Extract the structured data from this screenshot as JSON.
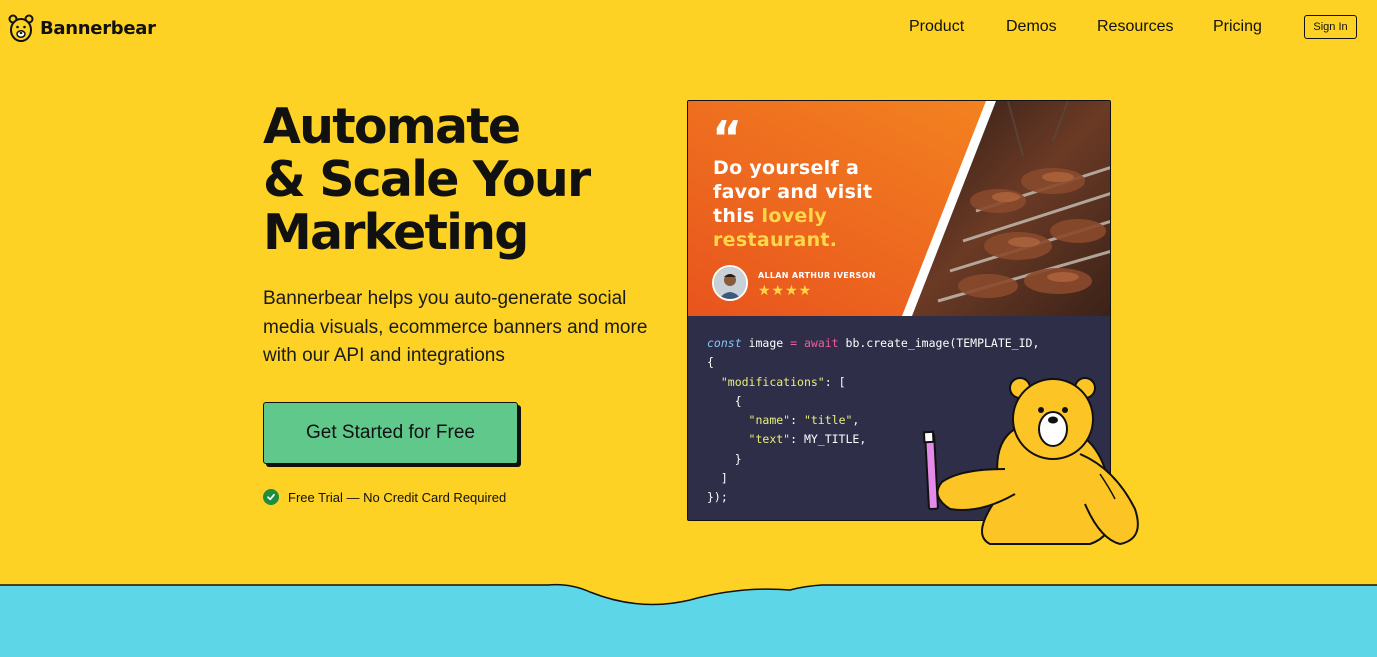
{
  "nav": {
    "brand": "Bannerbear",
    "links": [
      "Product",
      "Demos",
      "Resources",
      "Pricing"
    ],
    "sign_in": "Sign In"
  },
  "hero": {
    "title_lines": [
      "Automate",
      "& Scale Your",
      "Marketing"
    ],
    "subtitle": "Bannerbear helps you auto-generate social media visuals, ecommerce banners and more with our API and integrations",
    "cta": "Get Started for Free",
    "trial_note": "Free Trial — No Credit Card Required"
  },
  "banner": {
    "quote_mark": "“",
    "quote_plain": "Do yourself a favor and visit this ",
    "quote_highlight": "lovely restaurant.",
    "author": "ALLAN ARTHUR IVERSON",
    "stars": "★★★★",
    "rating": 4
  },
  "code": {
    "l1_kw": "const",
    "l1_a": " image ",
    "l1_op1": "=",
    "l1_sp": " ",
    "l1_op2": "await",
    "l1_b": " bb.create_image(TEMPLATE_ID,",
    "l2": "{",
    "l3_str": "\"modifications\"",
    "l3_b": ": [",
    "l4": "    {",
    "l5_k": "\"name\"",
    "l5_v": "\"title\"",
    "l6_k": "\"text\"",
    "l6_v": ": MY_TITLE,",
    "l7": "    }",
    "l8": "  ]",
    "l9": "});"
  },
  "colors": {
    "background": "#FDD224",
    "cta": "#5FC88A",
    "code_bg": "#2E2E48",
    "banner_orange": "#F26A22",
    "wave_blue": "#5DD7E8",
    "check_green": "#1E8E3E"
  }
}
